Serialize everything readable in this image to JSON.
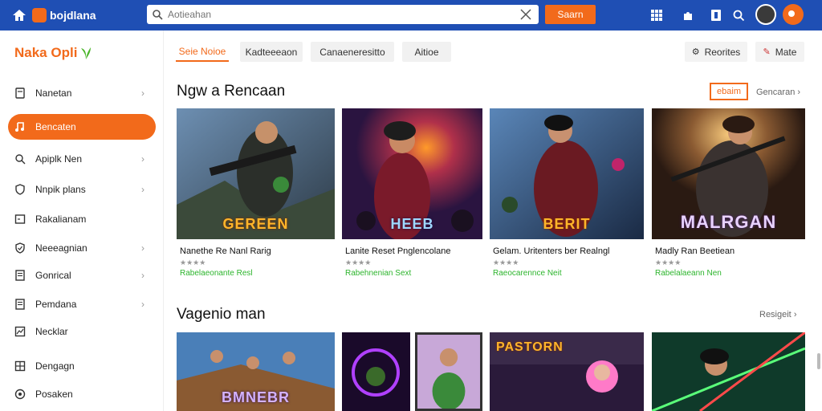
{
  "header": {
    "logo_text": "bojdlana",
    "search_placeholder": "Aotieahan",
    "search_button": "Saarn"
  },
  "sidebar": {
    "brand": "Naka Opli",
    "items": [
      {
        "label": "Nanetan",
        "icon": "page-icon",
        "chevron": true
      },
      {
        "label": "Bencaten",
        "icon": "music-icon",
        "active": true
      },
      {
        "label": "Apiplk Nen",
        "icon": "search-icon",
        "chevron": true
      },
      {
        "label": "Nnpik plans",
        "icon": "shield-icon",
        "chevron": true
      },
      {
        "label": "Rakalianam",
        "icon": "box-icon"
      },
      {
        "label": "Neeeagnian",
        "icon": "shield-check-icon",
        "chevron": true
      },
      {
        "label": "Gonrical",
        "icon": "doc-icon",
        "chevron": true
      },
      {
        "label": "Pemdana",
        "icon": "doc-icon",
        "chevron": true
      },
      {
        "label": "Necklar",
        "icon": "chart-icon"
      },
      {
        "label": "Dengagn",
        "icon": "grid-icon"
      },
      {
        "label": "Posaken",
        "icon": "settings-icon"
      }
    ]
  },
  "tabs": [
    {
      "label": "Seie Noioe",
      "active": true
    },
    {
      "label": "Kadteeeaon"
    },
    {
      "label": "Canaeneresitto"
    },
    {
      "label": "Aitioe"
    }
  ],
  "toolbar": {
    "reorder_label": "Reorites",
    "mute_label": "Mate"
  },
  "section1": {
    "title": "Ngw a Rencaan",
    "filter_label": "ebaim",
    "see_more": "Gencaran"
  },
  "cards": [
    {
      "name": "Nanethe Re Nanl Rarig",
      "rating": "★★★★",
      "tag": "Rabelaeonante Resl",
      "label": "GEREEN"
    },
    {
      "name": "Lanite Reset Pnglencolane",
      "rating": "★★★★",
      "tag": "Rabehnenian Sext",
      "label": "HEEB"
    },
    {
      "name": "Gelam. Uritenters ber Realngl",
      "rating": "★★★★",
      "tag": "Raeocarennce Neit",
      "label": "BERIT"
    },
    {
      "name": "Madly Ran Beetiean",
      "rating": "★★★★",
      "tag": "Rabelalaeann Nen",
      "label": "MALRGAN"
    }
  ],
  "section2": {
    "title": "Vagenio man",
    "see_more": "Resigeit"
  },
  "cards2": [
    {
      "label": "BMNEBR"
    },
    {
      "label": ""
    },
    {
      "label": ""
    },
    {
      "label": "PASTORN"
    },
    {
      "label": ""
    }
  ],
  "colors": {
    "header": "#1f4fb4",
    "accent": "#f26a1b",
    "green": "#2db52d"
  }
}
